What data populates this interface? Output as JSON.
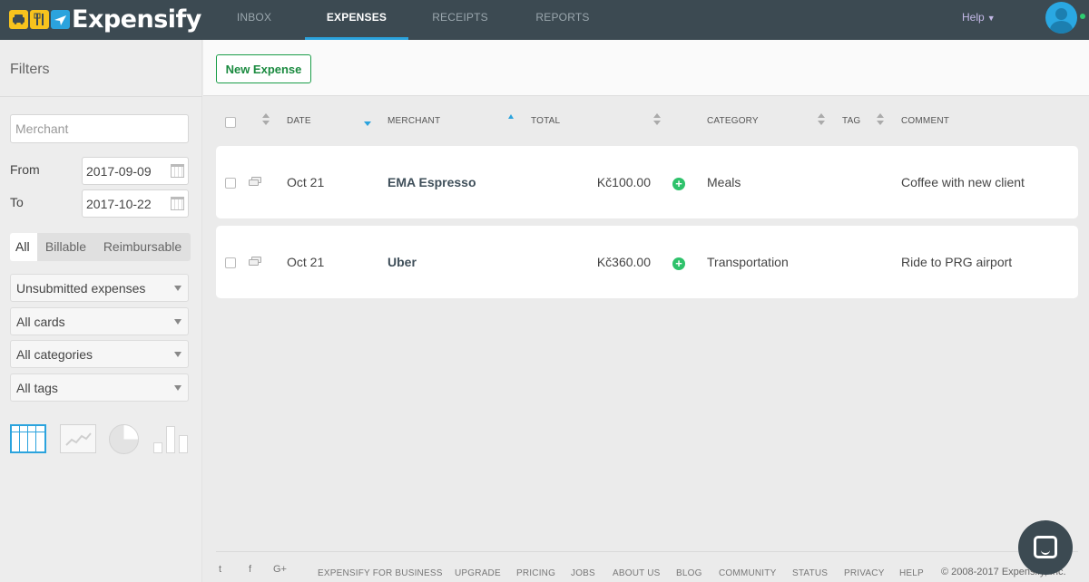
{
  "app": {
    "logo_text": "Expensify",
    "logo_icons": [
      "taxi-icon",
      "fork-knife-icon",
      "plane-icon"
    ]
  },
  "nav": {
    "tabs": [
      {
        "label": "INBOX",
        "active": false
      },
      {
        "label": "EXPENSES",
        "active": true
      },
      {
        "label": "RECEIPTS",
        "active": false
      },
      {
        "label": "REPORTS",
        "active": false
      }
    ],
    "help_label": "Help"
  },
  "sidebar": {
    "title": "Filters",
    "merchant_placeholder": "Merchant",
    "from_label": "From",
    "from_value": "2017-09-09",
    "to_label": "To",
    "to_value": "2017-10-22",
    "segments": [
      {
        "label": "All",
        "active": true
      },
      {
        "label": "Billable",
        "active": false
      },
      {
        "label": "Reimbursable",
        "active": false
      }
    ],
    "dropdowns": [
      "Unsubmitted expenses",
      "All cards",
      "All categories",
      "All tags"
    ],
    "view_icons": [
      "table-view-icon",
      "line-chart-icon",
      "pie-chart-icon",
      "bar-chart-icon"
    ]
  },
  "toolbar": {
    "new_expense_label": "New Expense"
  },
  "table": {
    "columns": {
      "date": "DATE",
      "merchant": "MERCHANT",
      "total": "TOTAL",
      "category": "CATEGORY",
      "tag": "TAG",
      "comment": "COMMENT"
    },
    "rows": [
      {
        "date": "Oct 21",
        "merchant": "EMA Espresso",
        "total": "Kč100.00",
        "category": "Meals",
        "comment": "Coffee with new client"
      },
      {
        "date": "Oct 21",
        "merchant": "Uber",
        "total": "Kč360.00",
        "category": "Transportation",
        "comment": "Ride to PRG airport"
      }
    ]
  },
  "footer": {
    "social": [
      "t",
      "f",
      "G+"
    ],
    "links": [
      "EXPENSIFY FOR BUSINESS",
      "UPGRADE",
      "PRICING",
      "JOBS",
      "ABOUT US",
      "BLOG",
      "COMMUNITY",
      "STATUS",
      "PRIVACY",
      "HELP"
    ],
    "copyright": "© 2008-2017 Expensify, Inc."
  },
  "colors": {
    "topbar": "#3c4a52",
    "accent_blue": "#2ba3dd",
    "accent_green": "#1a9d48",
    "background": "#ebebeb"
  }
}
